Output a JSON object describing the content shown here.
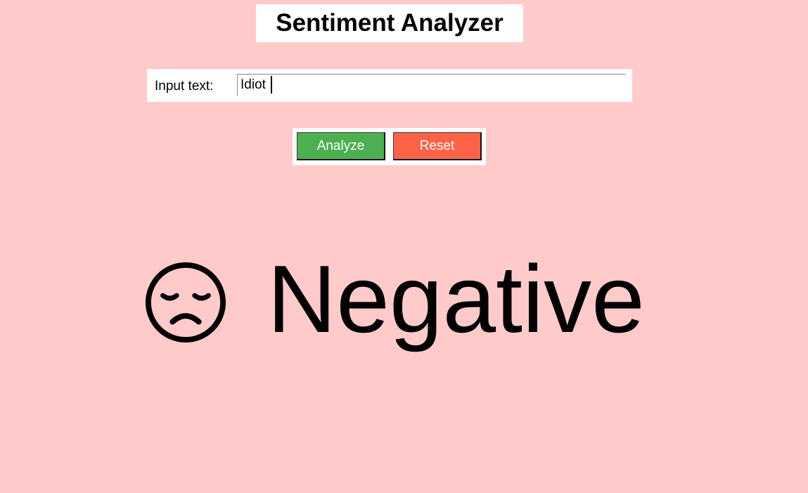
{
  "app": {
    "title": "Sentiment Analyzer"
  },
  "input": {
    "label": "Input text:",
    "value": "Idiot"
  },
  "buttons": {
    "analyze_label": "Analyze",
    "reset_label": "Reset"
  },
  "result": {
    "icon": "sad-face-icon",
    "label": "Negative"
  },
  "colors": {
    "background": "#ffcaca",
    "analyze_button": "#4caf50",
    "reset_button": "#ff6347"
  }
}
